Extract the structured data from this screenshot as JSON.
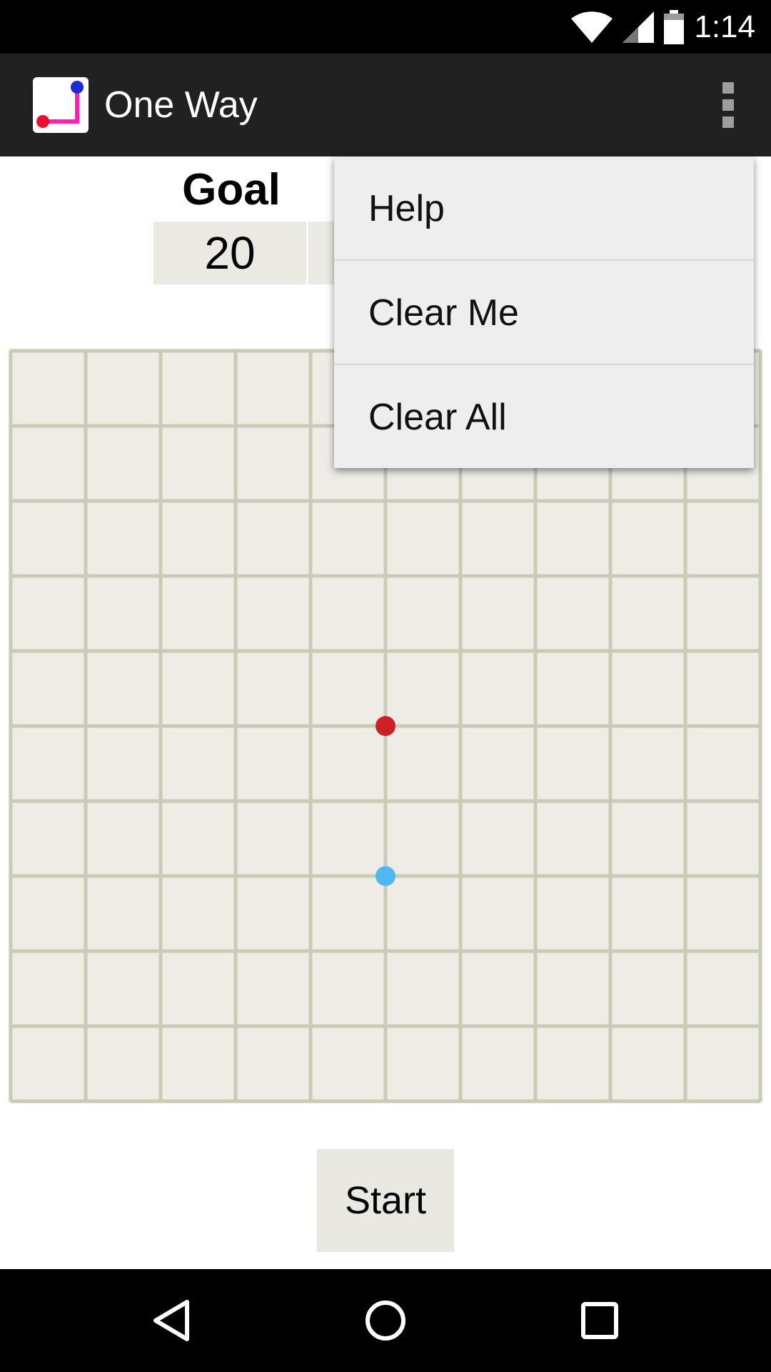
{
  "status_bar": {
    "time": "1:14",
    "icons": [
      "wifi-icon",
      "cell-signal-icon",
      "battery-icon"
    ]
  },
  "action_bar": {
    "title": "One Way",
    "icon": "one-way-app-icon",
    "overflow_icon": "more-vertical-icon"
  },
  "score": {
    "goal_label": "Goal",
    "goal_value": "20"
  },
  "grid": {
    "rows": 10,
    "columns": 10,
    "line_color": "#c9cbb6",
    "background": "#efece6",
    "markers": [
      {
        "name": "red-dot",
        "color": "#cc1f26",
        "col": 5,
        "row": 5
      },
      {
        "name": "blue-dot",
        "color": "#4fb8f4",
        "col": 5,
        "row": 7
      }
    ]
  },
  "start_button": {
    "label": "Start"
  },
  "menu": {
    "items": [
      {
        "label": "Help"
      },
      {
        "label": "Clear Me"
      },
      {
        "label": "Clear All"
      }
    ]
  },
  "nav_bar": {
    "icons": [
      "back-icon",
      "home-icon",
      "recents-icon"
    ]
  }
}
